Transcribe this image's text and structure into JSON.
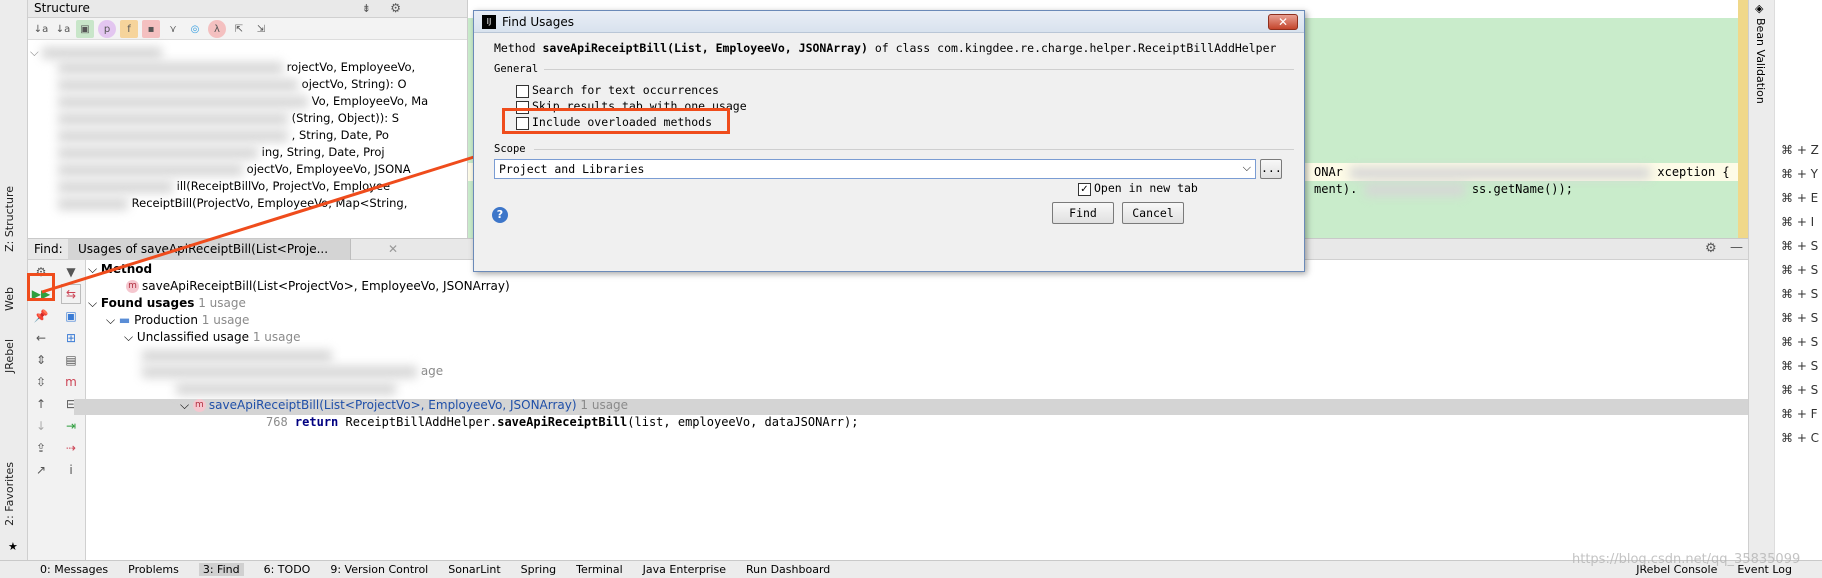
{
  "structure": {
    "title": "Structure",
    "rows": [
      "rojectVo, EmployeeVo,",
      "ojectVo, String): O",
      "Vo, EmployeeVo, Ma",
      "(String, Object)): S",
      ", String, Date, Po",
      "ing, String, Date, Proj",
      "ojectVo, EmployeeVo, JSONA",
      "ill(ReceiptBillVo, ProjectVo, Employee",
      "ReceiptBill(ProjectVo, EmployeeVo, Map<String,"
    ]
  },
  "editor": {
    "line1": "ONAr",
    "line1_end": "xception {",
    "line2": "ment).",
    "line2_end": "ss.getName());"
  },
  "left_tabs": {
    "structure": "Z: Structure",
    "web": "Web",
    "jrebel": "JRebel",
    "favorites": "2: Favorites"
  },
  "right_tabs": {
    "bean_validation": "Bean Validation"
  },
  "right_panel": {
    "keys": [
      "⌘ + Z",
      "⌘ + Y",
      "⌘ + E",
      "⌘ + I",
      "⌘ + S",
      "⌘ + S",
      "⌘ + S",
      "⌘ + S",
      "⌘ + S",
      "⌘ + S",
      "⌘ + S",
      "⌘ + F",
      "⌘ + C"
    ]
  },
  "find_panel": {
    "find_label": "Find:",
    "tab_label": "Usages of saveApiReceiptBill(List<Proje...",
    "method_header": "Method",
    "method_sig": "saveApiReceiptBill(List<ProjectVo>, EmployeeVo, JSONArray)",
    "found_usages": "Found usages",
    "found_count": "1 usage",
    "production": "Production",
    "production_count": "1 usage",
    "unclassified": "Unclassified usage",
    "unclassified_count": "1 usage",
    "package_usage": "age",
    "method_node": "saveApiReceiptBill(List<ProjectVo>, EmployeeVo, JSONArray)",
    "method_node_count": "1 usage",
    "line_number": "768",
    "code_keyword": "return",
    "code_class": "ReceiptBillAddHelper.",
    "code_method": "saveApiReceiptBill",
    "code_args": "(list, employeeVo, dataJSONArr);"
  },
  "status_bar": {
    "items": [
      "0: Messages",
      "Problems",
      "3: Find",
      "6: TODO",
      "9: Version Control",
      "SonarLint",
      "Spring",
      "Terminal",
      "Java Enterprise",
      "Run Dashboard"
    ],
    "right_items": [
      "JRebel Console",
      "Event Log"
    ],
    "watermark": "https://blog.csdn.net/qq_35835099"
  },
  "dialog": {
    "title": "Find Usages",
    "close_label": "✕",
    "method_prefix": "Method",
    "method_name": "saveApiReceiptBill(List, EmployeeVo, JSONArray)",
    "method_suffix": "of class com.kingdee.re.charge.helper.ReceiptBillAddHelper",
    "general_label": "General",
    "options": [
      {
        "label": "Search for text occurrences",
        "checked": false
      },
      {
        "label": "Skip results tab with one usage",
        "checked": false
      },
      {
        "label": "Include overloaded methods",
        "checked": false
      }
    ],
    "scope_label": "Scope",
    "scope_value": "Project and Libraries",
    "scope_more": "...",
    "open_new_tab_label": "Open in new tab",
    "open_new_tab_checked": true,
    "help_label": "?",
    "find_button": "Find",
    "cancel_button": "Cancel"
  },
  "colors": {
    "highlight": "#ef4c1c",
    "editor_bg": "#c9eccb",
    "selection_row": "#d4d4d4"
  }
}
